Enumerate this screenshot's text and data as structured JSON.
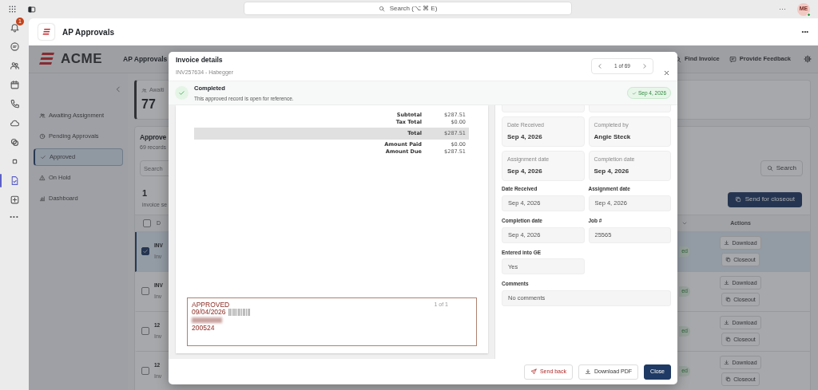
{
  "topbar": {
    "search_placeholder": "Search (⌥ ⌘ E)",
    "menu": "···",
    "avatar": "ME"
  },
  "rail": {
    "items": [
      {
        "kind": "bell",
        "selected": false,
        "badge": "1"
      },
      {
        "kind": "chat",
        "selected": false
      },
      {
        "kind": "people",
        "selected": false
      },
      {
        "kind": "calendar",
        "selected": false
      },
      {
        "kind": "phone",
        "selected": false
      },
      {
        "kind": "cloud",
        "selected": false
      },
      {
        "kind": "circles",
        "selected": false
      },
      {
        "kind": "square",
        "selected": false
      },
      {
        "kind": "document",
        "selected": true
      },
      {
        "kind": "plus",
        "selected": false
      }
    ],
    "more": "•••"
  },
  "app_header": {
    "title": "AP Approvals",
    "menu": "•••"
  },
  "navbar": {
    "brand": "ACME",
    "title": "AP Approvals",
    "links": [
      {
        "label": "Find Invoice",
        "kind": "search"
      },
      {
        "label": "Provide Feedback",
        "kind": "feedback"
      }
    ]
  },
  "sidebar": {
    "items": [
      {
        "label": "Awaiting Assignment",
        "kind": "people",
        "selected": false
      },
      {
        "label": "Pending Approvals",
        "kind": "clock",
        "selected": false
      },
      {
        "label": "Approved",
        "kind": "check",
        "selected": true
      },
      {
        "label": "On Hold",
        "kind": "warning",
        "selected": false
      },
      {
        "label": "Dashboard",
        "kind": "chart",
        "selected": false
      }
    ]
  },
  "stat": {
    "label": "Awaiti",
    "value": "77"
  },
  "list": {
    "title": "Approve",
    "subtitle": "69 records",
    "search_placeholder": "Search",
    "search_button": "Search",
    "selected_count": "1",
    "selected_label": "invoice se",
    "send_button": "Send for closeout",
    "header_checked": false,
    "columns": [
      "D",
      "Actions"
    ],
    "rows": [
      {
        "code": "INV",
        "subtitle": "Inv",
        "checked": true,
        "selected": true,
        "status": "ed",
        "actions": [
          {
            "label": "Download",
            "kind": "download"
          },
          {
            "label": "Closeout",
            "kind": "copy"
          }
        ]
      },
      {
        "code": "INV",
        "subtitle": "Inv",
        "checked": false,
        "selected": false,
        "status": "ed",
        "actions": [
          {
            "label": "Download",
            "kind": "download"
          },
          {
            "label": "Closeout",
            "kind": "copy"
          }
        ]
      },
      {
        "code": "12",
        "subtitle": "Inv",
        "checked": false,
        "selected": false,
        "status": "ed",
        "actions": [
          {
            "label": "Download",
            "kind": "download"
          },
          {
            "label": "Closeout",
            "kind": "copy"
          }
        ]
      },
      {
        "code": "12",
        "subtitle": "Inv",
        "checked": false,
        "selected": false,
        "status": "ed",
        "actions": [
          {
            "label": "Download",
            "kind": "download"
          },
          {
            "label": "Closeout",
            "kind": "copy"
          }
        ]
      }
    ]
  },
  "modal": {
    "title": "Invoice details",
    "subtitle": "INV257634 - Habegger",
    "pager": "1 of 69",
    "status": {
      "title": "Completed",
      "message": "This approved record is open for reference.",
      "badge": "Sep 4, 2026"
    },
    "document": {
      "totals": [
        {
          "label": "Subtotal",
          "value": "$287.51",
          "highlight": false
        },
        {
          "label": "Tax Total",
          "value": "$0.00",
          "highlight": false
        },
        {
          "label": "Total",
          "value": "$287.51",
          "highlight": true
        },
        {
          "label": "Amount Paid",
          "value": "$0.00",
          "highlight": false
        },
        {
          "label": "Amount Due",
          "value": "$287.51",
          "highlight": false
        }
      ],
      "stamp": {
        "status": "APPROVED",
        "date": "09/04/2026",
        "reference": "200524",
        "page_label": "1 of 1"
      }
    },
    "cards": [
      {
        "label": "Date Received",
        "value": "Sep 4, 2026"
      },
      {
        "label": "Completed by",
        "value": "Angie Steck"
      },
      {
        "label": "Assignment date",
        "value": "Sep 4, 2026"
      },
      {
        "label": "Completion date",
        "value": "Sep 4, 2026"
      }
    ],
    "fields": [
      {
        "label": "Date Received",
        "value": "Sep 4, 2026",
        "full_width": false
      },
      {
        "label": "Assignment date",
        "value": "Sep 4, 2026",
        "full_width": false
      },
      {
        "label": "Completion date",
        "value": "Sep 4, 2026",
        "full_width": false
      },
      {
        "label": "Job #",
        "value": "25565",
        "full_width": false
      },
      {
        "label": "Entered into GE",
        "value": "Yes",
        "full_width": false
      },
      {
        "label": "Comments",
        "value": "No comments",
        "full_width": true
      }
    ],
    "buttons": [
      {
        "label": "Send back",
        "kind": "danger"
      },
      {
        "label": "Download PDF",
        "kind": "secondary"
      },
      {
        "label": "Close",
        "kind": "primary"
      }
    ]
  }
}
